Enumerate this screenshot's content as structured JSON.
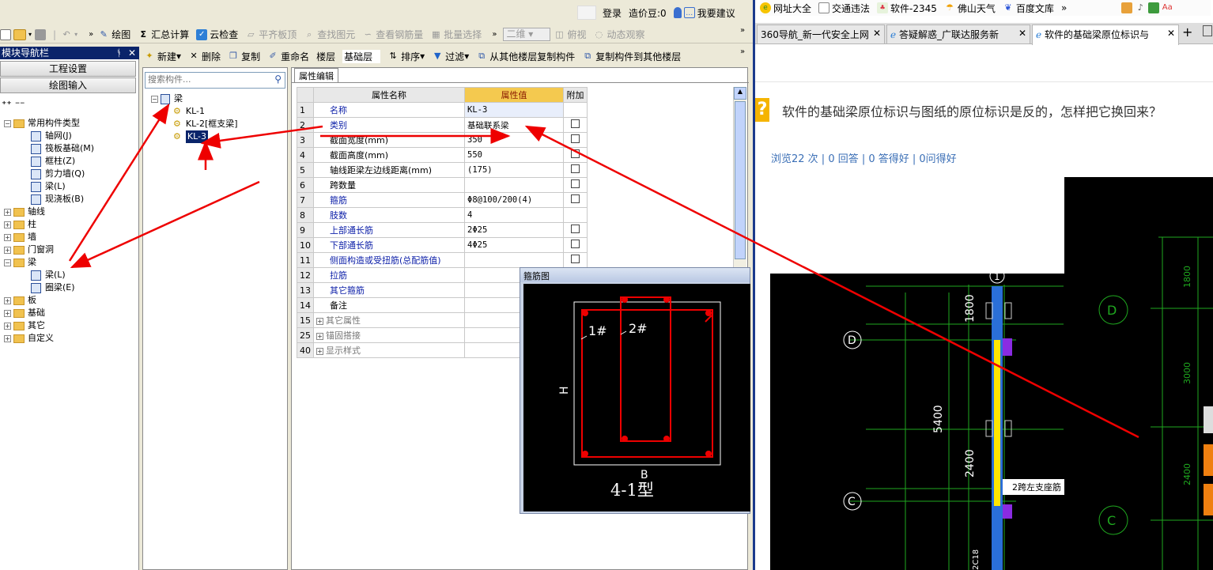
{
  "app": {
    "top_bar": {
      "login": "登录",
      "beans": "造价豆:0",
      "suggest": "我要建议"
    },
    "toolbar1": {
      "draw": "绘图",
      "sum_calc": "汇总计算",
      "cloud_check": "云检查",
      "flat_top": "平齐板顶",
      "find_elem": "查找图元",
      "view_rebar": "查看钢筋量",
      "batch_select": "批量选择",
      "dim_2d": "二维",
      "view": "俯视",
      "dynamic": "动态观察"
    },
    "nav": {
      "title": "模块导航栏",
      "btn_project": "工程设置",
      "btn_draw": "绘图输入"
    },
    "tree": [
      {
        "label": "常用构件类型",
        "level": 0,
        "expand": "−"
      },
      {
        "label": "轴网(J)",
        "level": 1
      },
      {
        "label": "筏板基础(M)",
        "level": 1
      },
      {
        "label": "框柱(Z)",
        "level": 1
      },
      {
        "label": "剪力墙(Q)",
        "level": 1
      },
      {
        "label": "梁(L)",
        "level": 1
      },
      {
        "label": "现浇板(B)",
        "level": 1
      },
      {
        "label": "轴线",
        "level": 0,
        "expand": "+"
      },
      {
        "label": "柱",
        "level": 0,
        "expand": "+"
      },
      {
        "label": "墙",
        "level": 0,
        "expand": "+"
      },
      {
        "label": "门窗洞",
        "level": 0,
        "expand": "+"
      },
      {
        "label": "梁",
        "level": 0,
        "expand": "−"
      },
      {
        "label": "梁(L)",
        "level": 1
      },
      {
        "label": "圈梁(E)",
        "level": 1
      },
      {
        "label": "板",
        "level": 0,
        "expand": "+"
      },
      {
        "label": "基础",
        "level": 0,
        "expand": "+"
      },
      {
        "label": "其它",
        "level": 0,
        "expand": "+"
      },
      {
        "label": "自定义",
        "level": 0,
        "expand": "+"
      }
    ],
    "toolbar2": {
      "new": "新建",
      "delete": "删除",
      "copy": "复制",
      "rename": "重命名",
      "floor_label": "楼层",
      "floor_value": "基础层",
      "sort": "排序",
      "filter": "过滤",
      "copy_from": "从其他楼层复制构件",
      "copy_to": "复制构件到其他楼层"
    },
    "search_placeholder": "搜索构件...",
    "components": {
      "root": "梁",
      "items": [
        "KL-1",
        "KL-2[框支梁]",
        "KL-3"
      ]
    },
    "prop_tab": "属性编辑",
    "prop_headers": [
      "属性名称",
      "属性值",
      "附加"
    ],
    "props": [
      {
        "n": "1",
        "name": "名称",
        "value": "KL-3",
        "blue": true,
        "cb": false
      },
      {
        "n": "2",
        "name": "类别",
        "value": "基础联系梁",
        "blue": true,
        "cb": true
      },
      {
        "n": "3",
        "name": "截面宽度(mm)",
        "value": "350",
        "blue": false,
        "cb": true
      },
      {
        "n": "4",
        "name": "截面高度(mm)",
        "value": "550",
        "blue": false,
        "cb": true
      },
      {
        "n": "5",
        "name": "轴线距梁左边线距离(mm)",
        "value": "(175)",
        "blue": false,
        "cb": true
      },
      {
        "n": "6",
        "name": "跨数量",
        "value": "",
        "blue": false,
        "cb": true
      },
      {
        "n": "7",
        "name": "箍筋",
        "value": "Φ8@100/200(4)",
        "blue": true,
        "cb": true
      },
      {
        "n": "8",
        "name": "肢数",
        "value": "4",
        "blue": true,
        "cb": false
      },
      {
        "n": "9",
        "name": "上部通长筋",
        "value": "2Φ25",
        "blue": true,
        "cb": true
      },
      {
        "n": "10",
        "name": "下部通长筋",
        "value": "4Φ25",
        "blue": true,
        "cb": true
      },
      {
        "n": "11",
        "name": "侧面构造或受扭筋(总配筋值)",
        "value": "",
        "blue": true,
        "cb": true
      },
      {
        "n": "12",
        "name": "拉筋",
        "value": "",
        "blue": true,
        "cb": false
      },
      {
        "n": "13",
        "name": "其它箍筋",
        "value": "",
        "blue": true,
        "cb": false
      },
      {
        "n": "14",
        "name": "备注",
        "value": "",
        "blue": false,
        "cb": false
      },
      {
        "n": "15",
        "name": "其它属性",
        "value": "",
        "blue": false,
        "cb": false,
        "group": true
      },
      {
        "n": "25",
        "name": "锚固搭接",
        "value": "",
        "blue": false,
        "cb": false,
        "group": true
      },
      {
        "n": "40",
        "name": "显示样式",
        "value": "",
        "blue": false,
        "cb": false,
        "group": true
      }
    ],
    "stirrup": {
      "title": "箍筋图",
      "label1": "1#",
      "label2": "2#",
      "h": "H",
      "b": "B",
      "type": "4-1型"
    }
  },
  "browser": {
    "favorites": [
      "网址大全",
      "交通违法",
      "软件-2345",
      "佛山天气",
      "百度文库"
    ],
    "tabs": [
      "360导航_新一代安全上网",
      "答疑解惑_广联达服务新",
      "软件的基础梁原位标识与"
    ],
    "question": "软件的基础梁原位标识与图纸的原位标识是反的，怎样把它换回来？",
    "stats": "浏览22 次 | 0 回答 | 0 答得好 | 0问得好",
    "cad": {
      "axis_d": "D",
      "axis_c": "C",
      "axis_1": "1",
      "dim_1800": "1800",
      "dim_5400": "5400",
      "dim_2400": "2400",
      "annot": "2跨左支座筋",
      "bottom_text": "2C18",
      "r_1800": "1800",
      "r_3000": "3000",
      "r_2400": "2400",
      "r_d": "D",
      "r_c": "C"
    }
  }
}
